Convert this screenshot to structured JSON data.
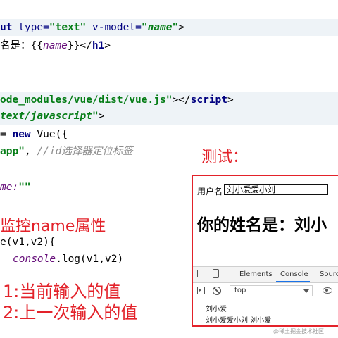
{
  "code": {
    "l1": {
      "a": "ut",
      "b": " type=",
      "c": "\"text\"",
      "d": " v-model=",
      "e": "\"",
      "f": "name",
      "g": "\"",
      "h": ">"
    },
    "l2": {
      "a": "名是：{{",
      "b": "name",
      "c": "}}</",
      "d": "h1",
      "e": ">"
    },
    "l3": {
      "a": "ode_modules/vue/dist/vue.js\"",
      "b": "></",
      "c": "script",
      "d": ">"
    },
    "l4": {
      "a": "text/javascript\"",
      "b": ">"
    },
    "l5": {
      "a": "= ",
      "b": "new",
      "c": " Vue({"
    },
    "l6": {
      "a": "app\"",
      "b": ", ",
      "c": "//id选择器定位标签"
    },
    "l7": {
      "a": "me:",
      "b": "\"\""
    },
    "l8": {
      "a": "e(",
      "b": "v1",
      "c": ",",
      "d": "v2",
      "e": "){"
    },
    "l9": {
      "a": "console",
      "b": ".log(",
      "c": "v1",
      "d": ",",
      "e": "v2",
      "f": ")"
    }
  },
  "annotations": {
    "test": "测试：",
    "watch": "监控name属性",
    "n1": "1:当前输入的值",
    "n2": "2:上一次输入的值"
  },
  "browser": {
    "label": "用户名",
    "input_value": "刘小爱爱小刘",
    "heading": "你的姓名是：刘小"
  },
  "devtools": {
    "tabs": [
      "Elements",
      "Console",
      "Sourc"
    ],
    "active_tab": "Console",
    "context": "top",
    "logs": [
      "刘小爱",
      "刘小爱爱小刘 刘小爱"
    ]
  },
  "watermark": "@稀土掘金技术社区"
}
